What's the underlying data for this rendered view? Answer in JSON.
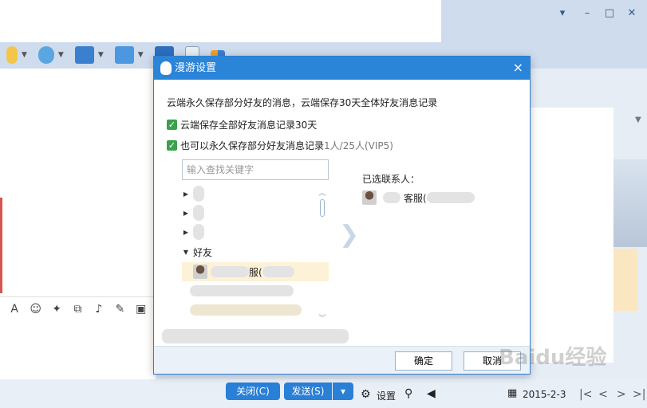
{
  "dialog": {
    "title": "漫游设置",
    "description": "云端永久保存部分好友的消息，云端保存30天全体好友消息记录",
    "option1": "云端保存全部好友消息记录30天",
    "option2_prefix": "也可以永久保存部分好友消息记录",
    "option2_quota": "1人/25人(VIP5)",
    "search_placeholder": "输入查找关键字",
    "group_friends": "好友",
    "friend_suffix": "服(",
    "selected_label": "已选联系人：",
    "selected_contact": "客服(",
    "ok": "确定",
    "cancel": "取消",
    "close_glyph": "×"
  },
  "chat": {
    "close_button": "关闭(C)",
    "send_button": "发送(S)",
    "settings": "设置",
    "date": "2015-2-3"
  },
  "watermark": "Baidu经验",
  "colors": {
    "accent": "#2a84d8",
    "check": "#3aa24b"
  }
}
